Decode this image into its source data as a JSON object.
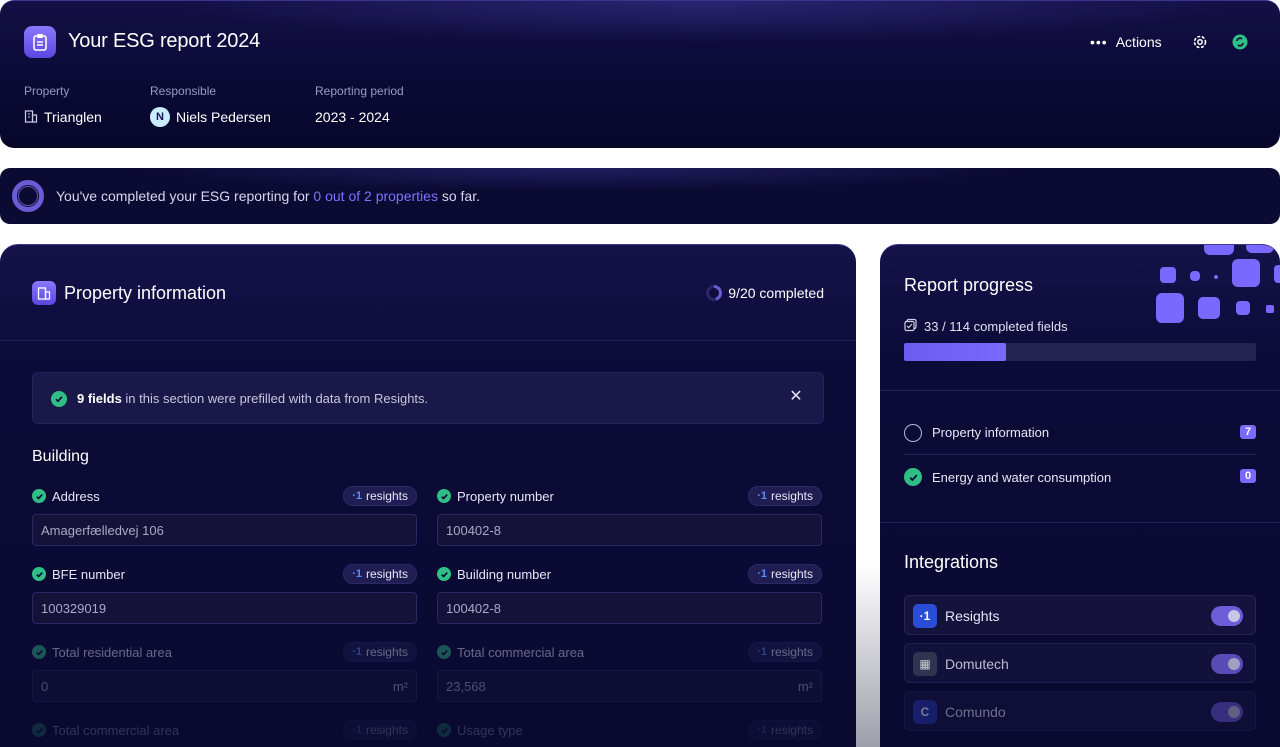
{
  "header": {
    "title": "Your ESG report 2024",
    "actions_label": "Actions",
    "property_label": "Property",
    "property_value": "Trianglen",
    "responsible_label": "Responsible",
    "responsible_initial": "N",
    "responsible_value": "Niels Pedersen",
    "period_label": "Reporting period",
    "period_value": "2023 - 2024",
    "icons": [
      "clipboard-icon",
      "more-dots-icon",
      "gear-icon",
      "status-sync-icon",
      "building-icon"
    ]
  },
  "banner": {
    "text_before": "You've completed your ESG reporting for ",
    "highlight": "0 out of 2 properties",
    "text_after": " so far."
  },
  "section": {
    "title": "Property information",
    "status": "9/20 completed",
    "progress_fraction": 0.45,
    "notice_bold": "9 fields",
    "notice_rest": " in this section were prefilled with data from Resights.",
    "group_title": "Building",
    "badge_mark": "·1",
    "badge_label": "resights",
    "fields": [
      {
        "label": "Address",
        "value": "Amagerfælledvej 106",
        "unit": ""
      },
      {
        "label": "Property number",
        "value": "100402-8",
        "unit": ""
      },
      {
        "label": "BFE number",
        "value": "100329019",
        "unit": ""
      },
      {
        "label": "Building number",
        "value": "100402-8",
        "unit": ""
      },
      {
        "label": "Total residential area",
        "value": "0",
        "unit": "m²"
      },
      {
        "label": "Total commercial area",
        "value": "23,568",
        "unit": "m²"
      },
      {
        "label": "Total commercial area",
        "value": "",
        "unit": ""
      },
      {
        "label": "Usage type",
        "value": "",
        "unit": ""
      }
    ]
  },
  "report": {
    "title": "Report progress",
    "count": "33 / 114 completed fields",
    "progress_fraction": 0.289,
    "rows": [
      {
        "label": "Property information",
        "count": "7",
        "done": false
      },
      {
        "label": "Energy and water consumption",
        "count": "0",
        "done": true
      }
    ]
  },
  "integrations": {
    "title": "Integrations",
    "items": [
      {
        "name": "Resights",
        "logo": "·1",
        "color": "#2a4dd6",
        "enabled": true
      },
      {
        "name": "Domutech",
        "logo": "▦",
        "color": "#3a3f55",
        "enabled": true
      },
      {
        "name": "Comundo",
        "logo": "C",
        "color": "#2a3ab0",
        "enabled": true
      }
    ]
  }
}
